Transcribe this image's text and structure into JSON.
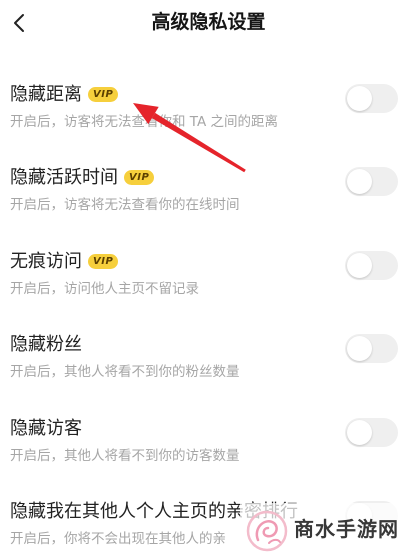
{
  "header": {
    "title": "高级隐私设置"
  },
  "icons": {
    "back": "chevron-left-icon",
    "toggle": "toggle-switch",
    "annotation": "red-arrow",
    "watermark_logo": "swirl-logo"
  },
  "settings": [
    {
      "title": "隐藏距离",
      "badge": "VIP",
      "subtitle": "开启后，访客将无法查看你和 TA 之间的距离",
      "enabled": false
    },
    {
      "title": "隐藏活跃时间",
      "badge": "VIP",
      "subtitle": "开启后，访客将无法查看你的在线时间",
      "enabled": false
    },
    {
      "title": "无痕访问",
      "badge": "VIP",
      "subtitle": "开启后，访问他人主页不留记录",
      "enabled": false
    },
    {
      "title": "隐藏粉丝",
      "subtitle": "开启后，其他人将看不到你的粉丝数量",
      "enabled": false
    },
    {
      "title": "隐藏访客",
      "subtitle": "开启后，其他人将看不到你的访客数量",
      "enabled": false
    },
    {
      "title": "隐藏我在其他人个人主页的亲密排行",
      "subtitle": "开启后，你将不会出现在其他人的亲",
      "enabled": false
    }
  ],
  "watermark": {
    "text": "商水手游网"
  },
  "colors": {
    "background": "#ffffff",
    "title_text": "#222222",
    "subtitle_text": "#a6a6a6",
    "vip_badge": "#f6cf3c",
    "vip_text": "#5b3f00",
    "toggle_off": "#efefef",
    "annotation_arrow": "#e5242b",
    "watermark_logo": "#ef9ab3"
  }
}
